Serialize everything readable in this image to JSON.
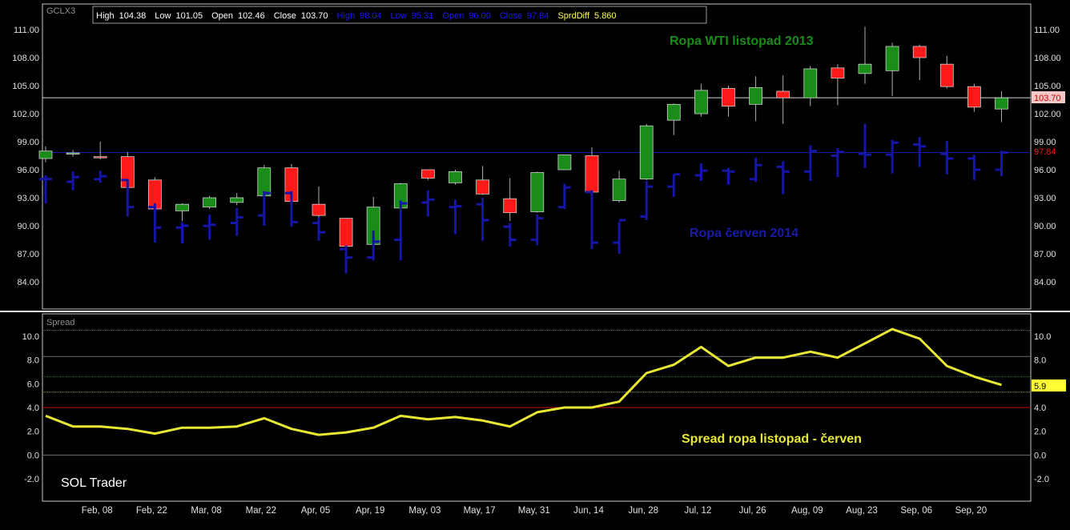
{
  "window": {
    "symbol": "GCLX3"
  },
  "header": {
    "items": [
      {
        "label": "High",
        "value": "104.38",
        "color": "#ffffff"
      },
      {
        "label": "Low",
        "value": "101.05",
        "color": "#ffffff"
      },
      {
        "label": "Open",
        "value": "102.46",
        "color": "#ffffff"
      },
      {
        "label": "Close",
        "value": "103.70",
        "color": "#ffffff"
      },
      {
        "label": "High",
        "value": "98.04",
        "color": "#1a1aff"
      },
      {
        "label": "Low",
        "value": "95.31",
        "color": "#1a1aff"
      },
      {
        "label": "Open",
        "value": "96.00",
        "color": "#1a1aff"
      },
      {
        "label": "Close",
        "value": "97.84",
        "color": "#1a1aff"
      },
      {
        "label": "SprdDiff",
        "value": "5.860",
        "color": "#ffff55"
      }
    ]
  },
  "colors": {
    "up": "#1a8c1a",
    "down": "#ff1a1a",
    "bar": "#1515a8",
    "spread": "#e8e832",
    "background": "#000000",
    "frame": "#c8c8c8"
  },
  "labels": {
    "wti_2013": "Ropa WTI listopad 2013",
    "cerven_2014": "Ropa červen 2014",
    "spread_title": "Spread ropa listopad - červen",
    "spread_panel": "Spread",
    "watermark": "SOL Trader"
  },
  "chart_data": [
    {
      "type": "candlestick",
      "name": "Ropa WTI listopad 2013",
      "ylim": [
        82,
        113
      ],
      "yticks": [
        "111.00",
        "108.00",
        "105.00",
        "102.00",
        "99.00",
        "96.00",
        "93.00",
        "90.00",
        "87.00",
        "84.00"
      ],
      "last_value_label": "103.70",
      "last_value": 103.7,
      "ohlc": [
        [
          97.2,
          98.5,
          96.8,
          98.0
        ],
        [
          97.8,
          98.1,
          97.4,
          97.8
        ],
        [
          97.4,
          99.0,
          97.1,
          97.3
        ],
        [
          97.4,
          97.9,
          93.4,
          94.1
        ],
        [
          94.9,
          95.2,
          90.7,
          91.8
        ],
        [
          91.6,
          92.4,
          90.5,
          92.3
        ],
        [
          92.0,
          93.2,
          91.8,
          93.0
        ],
        [
          92.5,
          93.5,
          92.2,
          93.0
        ],
        [
          93.2,
          96.5,
          93.1,
          96.2
        ],
        [
          96.2,
          96.6,
          92.0,
          92.6
        ],
        [
          92.3,
          94.2,
          90.8,
          91.1
        ],
        [
          90.8,
          90.8,
          85.2,
          87.8
        ],
        [
          88.0,
          93.1,
          87.7,
          92.0
        ],
        [
          91.9,
          94.6,
          86.8,
          94.5
        ],
        [
          96.0,
          96.0,
          94.9,
          95.1
        ],
        [
          94.6,
          96.0,
          94.4,
          95.8
        ],
        [
          94.9,
          96.4,
          93.3,
          93.4
        ],
        [
          92.9,
          95.1,
          90.5,
          91.4
        ],
        [
          91.5,
          95.8,
          91.4,
          95.7
        ],
        [
          96.0,
          97.5,
          96.0,
          97.6
        ],
        [
          97.5,
          98.4,
          92.3,
          93.6
        ],
        [
          92.7,
          95.9,
          92.5,
          95.0
        ],
        [
          95.0,
          100.9,
          94.9,
          100.7
        ],
        [
          101.3,
          103.1,
          99.7,
          103.0
        ],
        [
          102.0,
          105.2,
          101.7,
          104.5
        ],
        [
          104.7,
          105.0,
          101.7,
          102.8
        ],
        [
          103.0,
          106.0,
          101.2,
          104.8
        ],
        [
          104.4,
          106.1,
          100.9,
          103.7
        ],
        [
          103.7,
          107.1,
          102.8,
          106.8
        ],
        [
          106.9,
          107.3,
          102.9,
          105.8
        ],
        [
          106.3,
          111.3,
          105.2,
          107.3
        ],
        [
          106.6,
          109.6,
          103.9,
          109.2
        ],
        [
          109.2,
          109.4,
          105.6,
          108.0
        ],
        [
          107.3,
          108.2,
          104.7,
          104.9
        ],
        [
          104.9,
          105.2,
          102.2,
          102.7
        ],
        [
          102.5,
          104.4,
          101.1,
          103.7
        ]
      ]
    },
    {
      "type": "ohlc",
      "name": "Ropa červen 2014",
      "last_value_label": "97.84",
      "last_value": 97.84,
      "ohlc": [
        [
          95.0,
          95.4,
          92.4,
          95.0
        ],
        [
          94.7,
          95.8,
          93.8,
          95.2
        ],
        [
          95.0,
          95.9,
          94.6,
          95.3
        ],
        [
          94.9,
          95.0,
          91.0,
          92.0
        ],
        [
          92.0,
          92.4,
          88.2,
          89.8
        ],
        [
          89.8,
          90.4,
          88.1,
          90.0
        ],
        [
          90.0,
          91.2,
          88.5,
          90.1
        ],
        [
          90.3,
          91.9,
          88.9,
          90.9
        ],
        [
          91.1,
          93.7,
          90.0,
          93.5
        ],
        [
          93.5,
          93.7,
          89.9,
          90.4
        ],
        [
          90.3,
          90.9,
          88.4,
          89.3
        ],
        [
          87.5,
          87.9,
          84.9,
          86.6
        ],
        [
          86.6,
          89.5,
          86.3,
          88.3
        ],
        [
          88.5,
          92.7,
          86.3,
          92.4
        ],
        [
          92.5,
          93.8,
          91.0,
          92.8
        ],
        [
          92.0,
          92.8,
          89.1,
          92.1
        ],
        [
          92.3,
          93.0,
          88.4,
          90.6
        ],
        [
          89.9,
          90.3,
          87.8,
          88.5
        ],
        [
          88.5,
          91.2,
          87.9,
          90.8
        ],
        [
          92.0,
          94.5,
          91.8,
          94.1
        ],
        [
          93.6,
          93.8,
          87.5,
          88.2
        ],
        [
          88.2,
          90.4,
          87.0,
          90.6
        ],
        [
          91.0,
          94.8,
          90.6,
          94.2
        ],
        [
          94.2,
          95.5,
          93.1,
          95.5
        ],
        [
          95.4,
          96.7,
          94.8,
          95.9
        ],
        [
          95.9,
          96.2,
          94.4,
          95.8
        ],
        [
          95.0,
          97.3,
          94.7,
          96.5
        ],
        [
          96.3,
          96.9,
          93.4,
          95.8
        ],
        [
          95.8,
          98.6,
          94.8,
          98.0
        ],
        [
          97.5,
          98.3,
          95.2,
          97.9
        ],
        [
          97.7,
          100.9,
          96.2,
          97.6
        ],
        [
          97.6,
          99.2,
          95.6,
          98.9
        ],
        [
          98.7,
          99.5,
          96.3,
          98.5
        ],
        [
          97.7,
          99.1,
          95.5,
          97.2
        ],
        [
          97.2,
          97.6,
          94.9,
          96.0
        ],
        [
          96.0,
          98.04,
          95.31,
          97.84
        ]
      ]
    },
    {
      "type": "line",
      "name": "Spread",
      "ylim": [
        -3,
        11
      ],
      "yticks": [
        "10.0",
        "8.0",
        "6.0",
        "4.0",
        "2.0",
        "0.0",
        "-2.0"
      ],
      "reference_lines": [
        10.5,
        8.3,
        6.6,
        5.3,
        4.0,
        0.0
      ],
      "last_value_label": "5.9",
      "values": [
        3.3,
        2.4,
        2.4,
        2.2,
        1.8,
        2.3,
        2.3,
        2.4,
        3.1,
        2.2,
        1.7,
        1.9,
        2.3,
        3.3,
        3.0,
        3.2,
        2.9,
        2.4,
        3.6,
        4.0,
        4.0,
        4.5,
        6.9,
        7.6,
        9.1,
        7.5,
        8.2,
        8.2,
        8.7,
        8.2,
        9.4,
        10.6,
        9.8,
        7.5,
        6.6,
        5.9
      ]
    }
  ],
  "x_axis": {
    "ticks": [
      "Feb, 08",
      "Feb, 22",
      "Mar, 08",
      "Mar, 22",
      "Apr, 05",
      "Apr, 19",
      "May, 03",
      "May, 17",
      "May, 31",
      "Jun, 14",
      "Jun, 28",
      "Jul, 12",
      "Jul, 26",
      "Aug, 09",
      "Aug, 23",
      "Sep, 06",
      "Sep, 20"
    ]
  }
}
